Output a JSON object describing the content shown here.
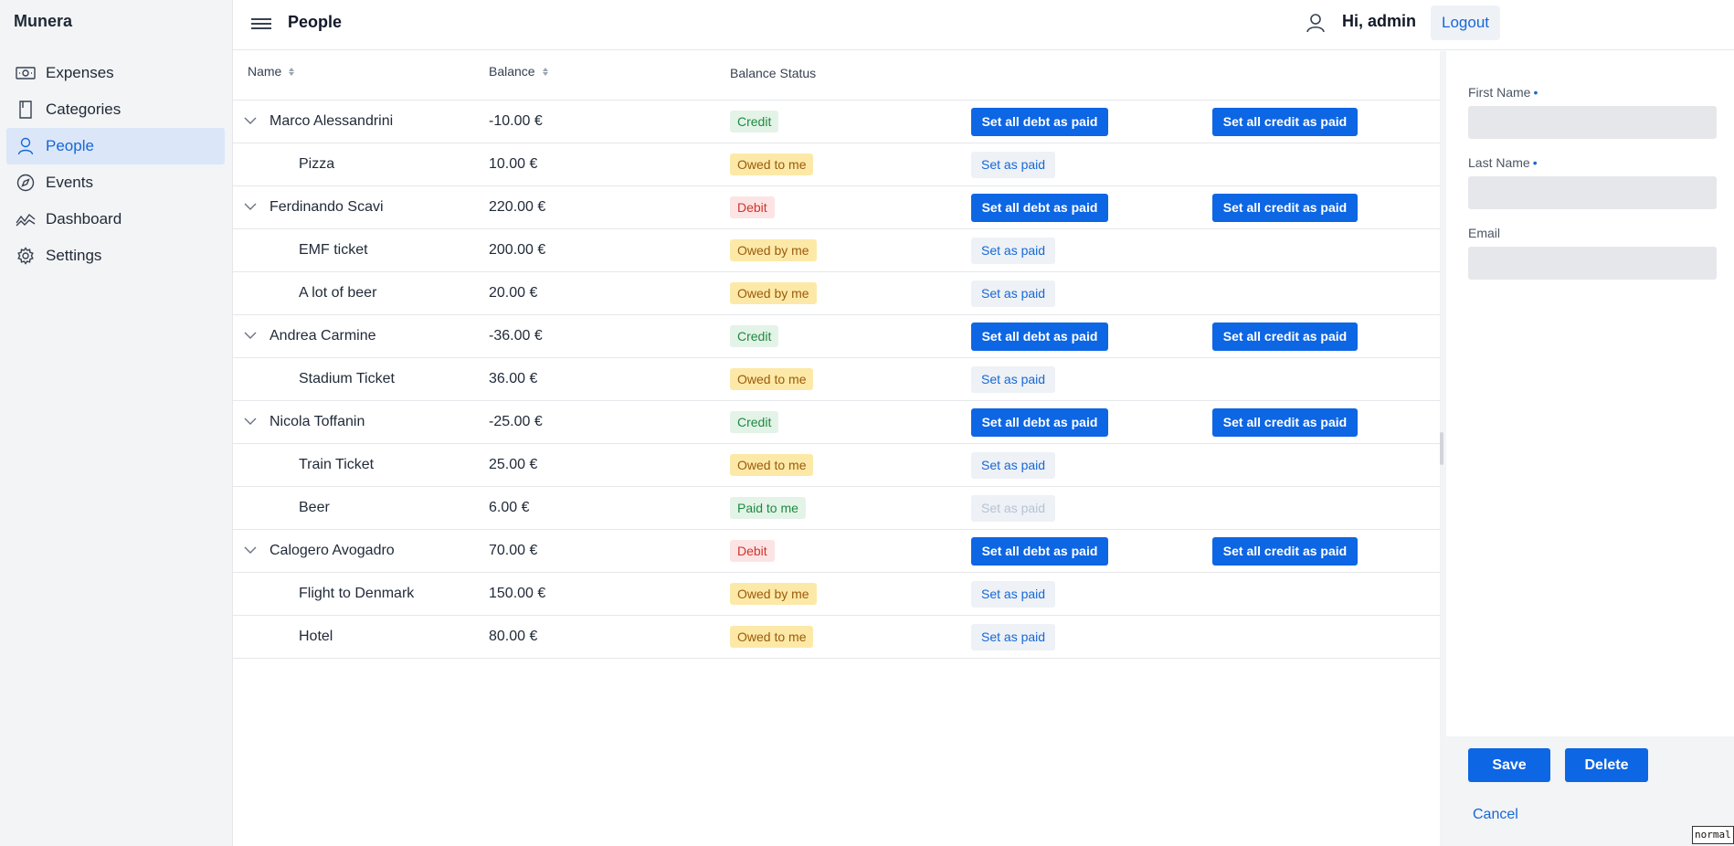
{
  "app": {
    "brand": "Munera"
  },
  "sidebar": {
    "items": [
      {
        "label": "Expenses",
        "icon": "money-icon",
        "active": false
      },
      {
        "label": "Categories",
        "icon": "bookmark-icon",
        "active": false
      },
      {
        "label": "People",
        "icon": "user-icon",
        "active": true
      },
      {
        "label": "Events",
        "icon": "compass-icon",
        "active": false
      },
      {
        "label": "Dashboard",
        "icon": "chart-line-icon",
        "active": false
      },
      {
        "label": "Settings",
        "icon": "gear-icon",
        "active": false
      }
    ]
  },
  "header": {
    "title": "People",
    "greeting": "Hi, admin",
    "logout_label": "Logout"
  },
  "table": {
    "columns": {
      "name": "Name",
      "balance": "Balance",
      "status": "Balance Status"
    },
    "rows": [
      {
        "kind": "person",
        "name": "Marco Alessandrini",
        "balance": "-10.00 €",
        "status": "Credit",
        "status_type": "credit",
        "debt_label": "Set all debt as paid",
        "credit_label": "Set all credit as paid"
      },
      {
        "kind": "item",
        "name": "Pizza",
        "balance": "10.00 €",
        "status": "Owed to me",
        "status_type": "owedto",
        "action_label": "Set as paid",
        "disabled": false
      },
      {
        "kind": "person",
        "name": "Ferdinando Scavi",
        "balance": "220.00 €",
        "status": "Debit",
        "status_type": "debit",
        "debt_label": "Set all debt as paid",
        "credit_label": "Set all credit as paid"
      },
      {
        "kind": "item",
        "name": "EMF ticket",
        "balance": "200.00 €",
        "status": "Owed by me",
        "status_type": "owedby",
        "action_label": "Set as paid",
        "disabled": false
      },
      {
        "kind": "item",
        "name": "A lot of beer",
        "balance": "20.00 €",
        "status": "Owed by me",
        "status_type": "owedby",
        "action_label": "Set as paid",
        "disabled": false
      },
      {
        "kind": "person",
        "name": "Andrea Carmine",
        "balance": "-36.00 €",
        "status": "Credit",
        "status_type": "credit",
        "debt_label": "Set all debt as paid",
        "credit_label": "Set all credit as paid"
      },
      {
        "kind": "item",
        "name": "Stadium Ticket",
        "balance": "36.00 €",
        "status": "Owed to me",
        "status_type": "owedto",
        "action_label": "Set as paid",
        "disabled": false
      },
      {
        "kind": "person",
        "name": "Nicola Toffanin",
        "balance": "-25.00 €",
        "status": "Credit",
        "status_type": "credit",
        "debt_label": "Set all debt as paid",
        "credit_label": "Set all credit as paid"
      },
      {
        "kind": "item",
        "name": "Train Ticket",
        "balance": "25.00 €",
        "status": "Owed to me",
        "status_type": "owedto",
        "action_label": "Set as paid",
        "disabled": false
      },
      {
        "kind": "item",
        "name": "Beer",
        "balance": "6.00 €",
        "status": "Paid to me",
        "status_type": "paidto",
        "action_label": "Set as paid",
        "disabled": true
      },
      {
        "kind": "person",
        "name": "Calogero Avogadro",
        "balance": "70.00 €",
        "status": "Debit",
        "status_type": "debit",
        "debt_label": "Set all debt as paid",
        "credit_label": "Set all credit as paid"
      },
      {
        "kind": "item",
        "name": "Flight to Denmark",
        "balance": "150.00 €",
        "status": "Owed by me",
        "status_type": "owedby",
        "action_label": "Set as paid",
        "disabled": false
      },
      {
        "kind": "item",
        "name": "Hotel",
        "balance": "80.00 €",
        "status": "Owed to me",
        "status_type": "owedto",
        "action_label": "Set as paid",
        "disabled": false
      }
    ]
  },
  "drawer": {
    "first_name_label": "First Name",
    "last_name_label": "Last Name",
    "email_label": "Email",
    "required_marker": "•",
    "first_name_value": "",
    "last_name_value": "",
    "email_value": "",
    "save_label": "Save",
    "delete_label": "Delete",
    "cancel_label": "Cancel"
  },
  "debug": {
    "mode_tag": "normal"
  },
  "colors": {
    "accent": "#0d66e4",
    "sidebar_active_bg": "#dbe7f8",
    "credit": "#1e8a3e",
    "debit": "#d0332c"
  }
}
